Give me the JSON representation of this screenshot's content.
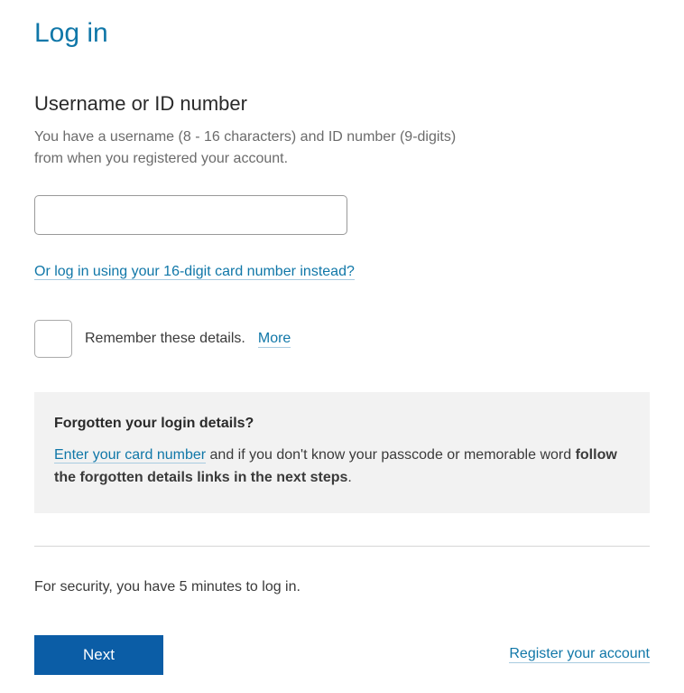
{
  "page": {
    "title": "Log in"
  },
  "username": {
    "label": "Username or ID number",
    "help_line1": "You have a username (8 - 16 characters) and ID number (9-digits)",
    "help_line2": "from when you registered your account.",
    "value": ""
  },
  "alt_login": {
    "link_text": "Or log in using your 16-digit card number instead?"
  },
  "remember": {
    "label": "Remember these details.",
    "more_link": "More"
  },
  "forgotten": {
    "title": "Forgotten your login details?",
    "link_text": "Enter your card number",
    "text_after": " and if you don't know your passcode or memorable word ",
    "bold_text": "follow the forgotten details links in the next steps",
    "period": "."
  },
  "security": {
    "note": "For security, you have 5 minutes to log in."
  },
  "actions": {
    "next_label": "Next",
    "register_link": "Register your account"
  }
}
